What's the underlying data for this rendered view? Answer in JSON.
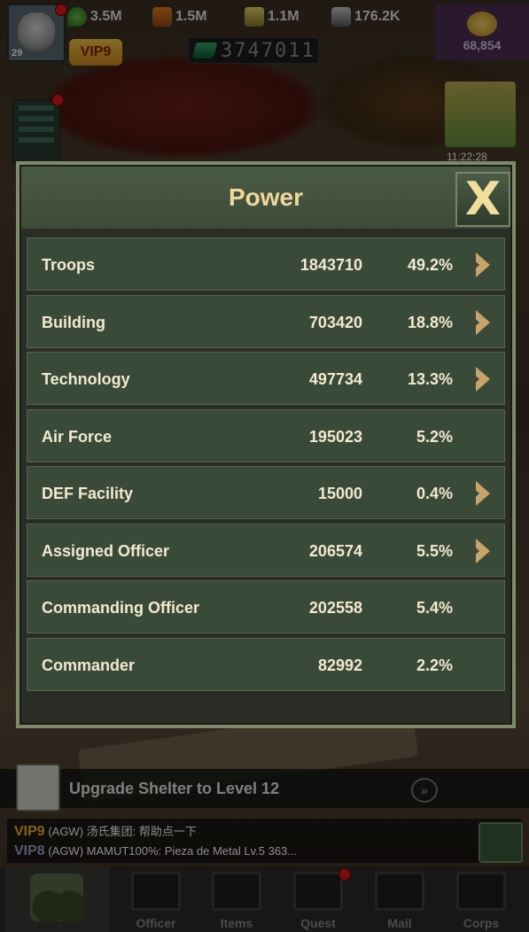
{
  "hud": {
    "avatar_level": "29",
    "vip_label": "VIP9",
    "resources": [
      {
        "name": "oil",
        "icon": "oil-drop-icon",
        "value": "3.5M"
      },
      {
        "name": "stone",
        "icon": "brick-icon",
        "value": "1.5M"
      },
      {
        "name": "ammo",
        "icon": "ammo-icon",
        "value": "1.1M"
      },
      {
        "name": "metal",
        "icon": "metal-icon",
        "value": "176.2K"
      }
    ],
    "power_value": "3747011",
    "gold_value": "68,854",
    "build_timer": "11:22:28"
  },
  "modal": {
    "title": "Power",
    "close_label": "X",
    "rows": [
      {
        "name": "Troops",
        "value": "1843710",
        "percent": "49.2%",
        "has_arrow": true
      },
      {
        "name": "Building",
        "value": "703420",
        "percent": "18.8%",
        "has_arrow": true
      },
      {
        "name": "Technology",
        "value": "497734",
        "percent": "13.3%",
        "has_arrow": true
      },
      {
        "name": "Air Force",
        "value": "195023",
        "percent": "5.2%",
        "has_arrow": false
      },
      {
        "name": "DEF Facility",
        "value": "15000",
        "percent": "0.4%",
        "has_arrow": true
      },
      {
        "name": "Assigned Officer",
        "value": "206574",
        "percent": "5.5%",
        "has_arrow": true
      },
      {
        "name": "Commanding Officer",
        "value": "202558",
        "percent": "5.4%",
        "has_arrow": false
      },
      {
        "name": "Commander",
        "value": "82992",
        "percent": "2.2%",
        "has_arrow": false
      }
    ]
  },
  "quest": {
    "text": "Upgrade Shelter to Level 12"
  },
  "chat": {
    "line1_vip": "VIP9",
    "line1_text": "(AGW) 汤氏集团: 帮助点一下",
    "line2_vip": "VIP8",
    "line2_text": "(AGW) MAMUT100%: Pieza de Metal Lv.5 363..."
  },
  "nav": {
    "tabs": [
      {
        "label": "Officer",
        "icon": "officer-icon"
      },
      {
        "label": "Items",
        "icon": "items-icon"
      },
      {
        "label": "Quest",
        "icon": "quest-icon"
      },
      {
        "label": "Mail",
        "icon": "mail-icon"
      },
      {
        "label": "Corps",
        "icon": "corps-flag-icon"
      }
    ]
  },
  "colors": {
    "title_gold": "#f1d89a",
    "row_bg": "#3a4a39",
    "arrow": "#c8a46a",
    "vip9": "#f0b030"
  }
}
